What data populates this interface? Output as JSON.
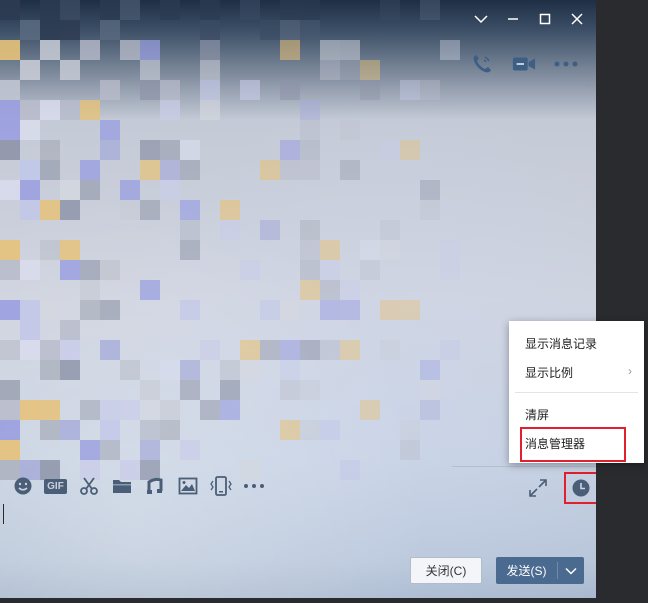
{
  "window": {
    "controls": {
      "dropdown_icon": "chevron-down-icon",
      "minimize_icon": "minimize-icon",
      "maximize_icon": "maximize-icon",
      "close_icon": "close-icon"
    }
  },
  "header": {
    "actions": [
      "phone-icon",
      "video-call-icon",
      "more-icon"
    ]
  },
  "toolbar": {
    "items": [
      "emoji-icon",
      "gif-icon",
      "scissors-icon",
      "folder-icon",
      "music-icon",
      "image-icon",
      "shake-icon",
      "more-icon"
    ],
    "gif_label": "GIF",
    "right_items": [
      "expand-icon",
      "clock-icon"
    ]
  },
  "context_menu": {
    "items": [
      {
        "label": "显示消息记录"
      },
      {
        "label": "显示比例",
        "has_submenu": true,
        "submenu_arrow": "›"
      },
      {
        "label": "清屏"
      },
      {
        "label": "消息管理器",
        "highlighted": true
      }
    ]
  },
  "footer": {
    "close_label": "关闭(C)",
    "send_label": "发送(S)",
    "send_dropdown_icon": "chevron-down-icon"
  },
  "colors": {
    "accent": "#4b6a8f",
    "highlight": "#e0202c"
  }
}
